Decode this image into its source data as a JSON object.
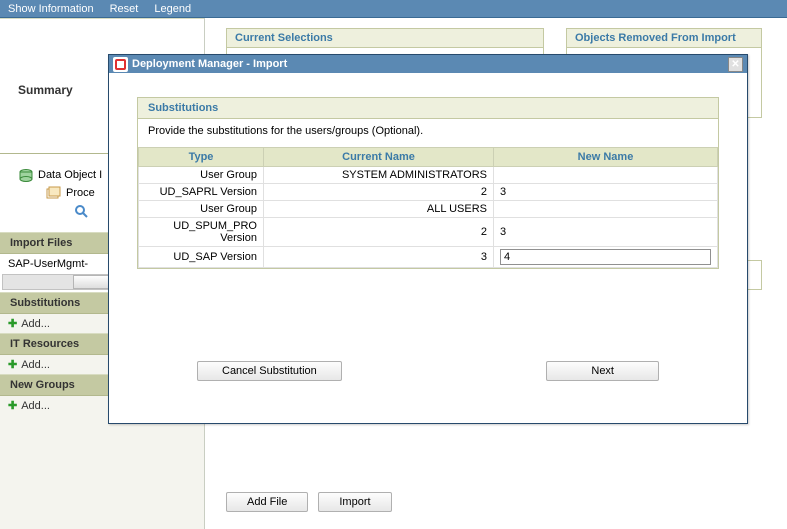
{
  "menu": {
    "show_info": "Show Information",
    "reset": "Reset",
    "legend": "Legend"
  },
  "sidebar": {
    "summary": "Summary",
    "tree": {
      "data_object": "Data Object I",
      "process": "Proce"
    },
    "import_files": "Import Files",
    "file": "SAP-UserMgmt-",
    "substitutions": "Substitutions",
    "it_resources": "IT Resources",
    "new_groups": "New Groups",
    "add": "Add..."
  },
  "panels": {
    "current_selections": "Current Selections",
    "removed": "Objects Removed From Import"
  },
  "footer": {
    "add_file": "Add File",
    "import": "Import"
  },
  "dialog": {
    "title": "Deployment Manager - Import",
    "sub_title": "Substitutions",
    "desc": "Provide the substitutions for the users/groups (Optional).",
    "cols": {
      "type": "Type",
      "current": "Current Name",
      "newname": "New Name"
    },
    "rows": [
      {
        "type": "User Group",
        "current": "SYSTEM ADMINISTRATORS",
        "newname": ""
      },
      {
        "type": "UD_SAPRL Version",
        "current": "2",
        "newname": "3"
      },
      {
        "type": "User Group",
        "current": "ALL USERS",
        "newname": ""
      },
      {
        "type": "UD_SPUM_PRO Version",
        "current": "2",
        "newname": "3"
      },
      {
        "type": "UD_SAP Version",
        "current": "3",
        "newname": "4"
      }
    ],
    "cancel": "Cancel Substitution",
    "next": "Next"
  }
}
